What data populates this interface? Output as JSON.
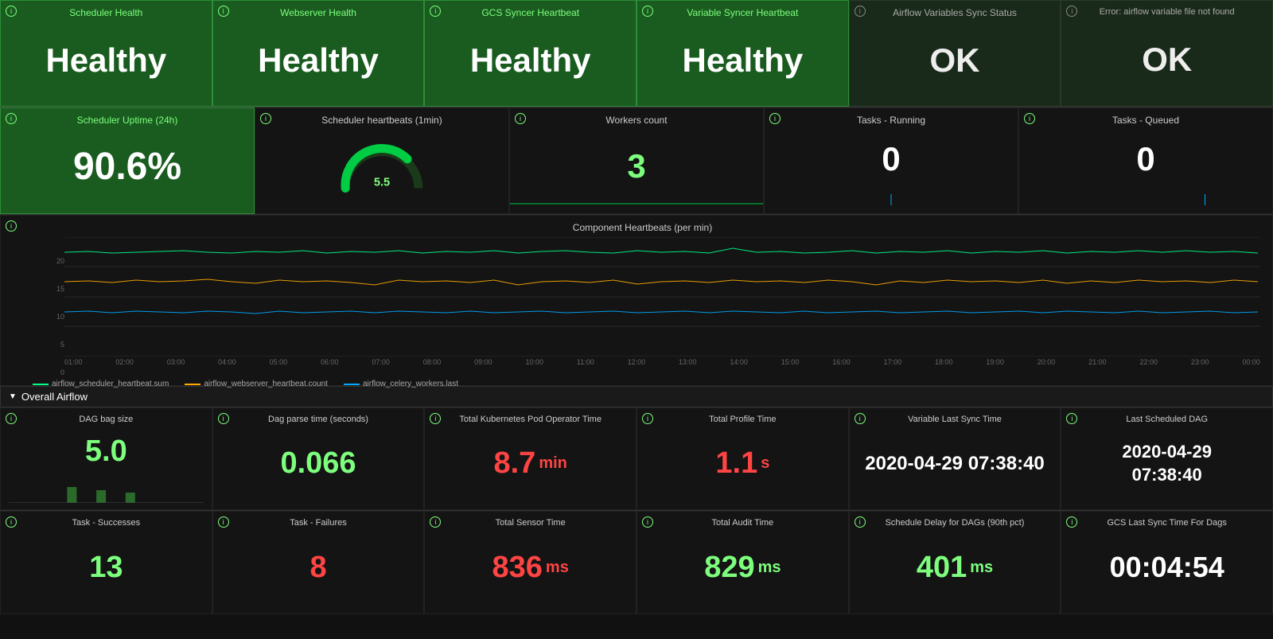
{
  "health_row": {
    "cards": [
      {
        "title": "Scheduler Health",
        "value": "Healthy",
        "dark": false
      },
      {
        "title": "Webserver Health",
        "value": "Healthy",
        "dark": false
      },
      {
        "title": "GCS Syncer Heartbeat",
        "value": "Healthy",
        "dark": false
      },
      {
        "title": "Variable Syncer Heartbeat",
        "value": "Healthy",
        "dark": false
      },
      {
        "title": "Airflow Variables Sync Status",
        "value": "OK",
        "dark": true
      },
      {
        "title": "Error: airflow variable file not found",
        "value": "OK",
        "dark": true
      }
    ]
  },
  "metrics_row": {
    "cards": [
      {
        "title": "Scheduler Uptime (24h)",
        "value": "90.6%",
        "type": "uptime"
      },
      {
        "title": "Scheduler heartbeats (1min)",
        "value": "5.5",
        "type": "gauge"
      },
      {
        "title": "Workers count",
        "value": "3",
        "type": "number"
      },
      {
        "title": "Tasks - Running",
        "value": "0",
        "type": "number_sparkline"
      },
      {
        "title": "Tasks - Queued",
        "value": "0",
        "type": "number_sparkline"
      }
    ]
  },
  "chart": {
    "title": "Component Heartbeats (per min)",
    "y_labels": [
      "20",
      "15",
      "10",
      "5",
      "0"
    ],
    "x_labels": [
      "01:00",
      "02:00",
      "03:00",
      "04:00",
      "05:00",
      "06:00",
      "07:00",
      "08:00",
      "09:00",
      "10:00",
      "11:00",
      "12:00",
      "13:00",
      "14:00",
      "15:00",
      "16:00",
      "17:00",
      "18:00",
      "19:00",
      "20:00",
      "21:00",
      "22:00",
      "23:00",
      "00:00"
    ],
    "legend": [
      {
        "label": "airflow_scheduler_heartbeat.sum",
        "color": "#00ff88"
      },
      {
        "label": "airflow_webserver_heartbeat.count",
        "color": "#ffaa00"
      },
      {
        "label": "airflow_celery_workers.last",
        "color": "#00aaff"
      }
    ]
  },
  "section": {
    "label": "Overall Airflow"
  },
  "airflow_row1": {
    "cards": [
      {
        "title": "DAG bag size",
        "value": "5.0",
        "color": "green",
        "unit": "",
        "type": "bar"
      },
      {
        "title": "Dag parse time (seconds)",
        "value": "0.066",
        "color": "green",
        "unit": ""
      },
      {
        "title": "Total Kubernetes Pod Operator Time",
        "value": "8.7",
        "color": "red",
        "unit": "min"
      },
      {
        "title": "Total Profile Time",
        "value": "1.1",
        "color": "red",
        "unit": "s"
      },
      {
        "title": "Variable Last Sync Time",
        "value": "2020-04-29 07:38:40",
        "color": "white",
        "unit": ""
      },
      {
        "title": "Last Scheduled DAG",
        "value": "2020-04-29\n07:38:40",
        "color": "white",
        "unit": ""
      }
    ]
  },
  "airflow_row2": {
    "cards": [
      {
        "title": "Task - Successes",
        "value": "13",
        "color": "green",
        "unit": ""
      },
      {
        "title": "Task - Failures",
        "value": "8",
        "color": "red",
        "unit": ""
      },
      {
        "title": "Total Sensor Time",
        "value": "836",
        "color": "red",
        "unit": "ms"
      },
      {
        "title": "Total Audit Time",
        "value": "829",
        "color": "green",
        "unit": "ms"
      },
      {
        "title": "Schedule Delay for DAGs (90th pct)",
        "value": "401",
        "color": "green",
        "unit": "ms"
      },
      {
        "title": "GCS Last Sync Time For Dags",
        "value": "00:04:54",
        "color": "white",
        "unit": ""
      }
    ]
  }
}
